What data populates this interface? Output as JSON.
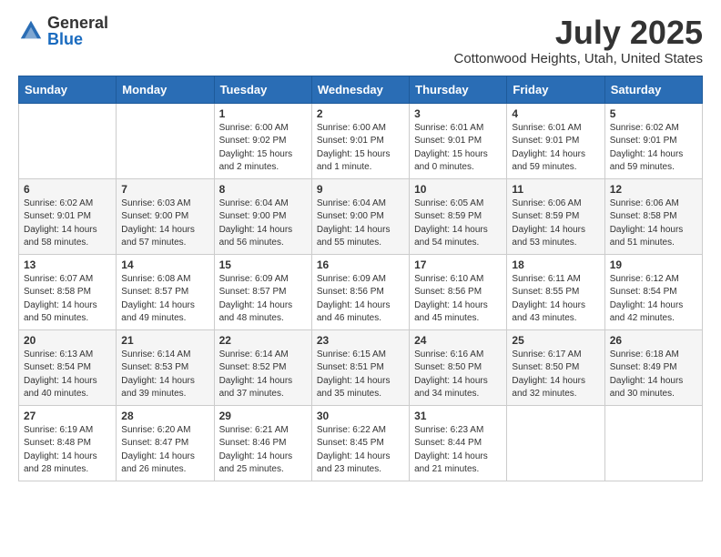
{
  "logo": {
    "general": "General",
    "blue": "Blue"
  },
  "title": {
    "month_year": "July 2025",
    "location": "Cottonwood Heights, Utah, United States"
  },
  "weekdays": [
    "Sunday",
    "Monday",
    "Tuesday",
    "Wednesday",
    "Thursday",
    "Friday",
    "Saturday"
  ],
  "weeks": [
    [
      {
        "day": "",
        "sunrise": "",
        "sunset": "",
        "daylight": ""
      },
      {
        "day": "",
        "sunrise": "",
        "sunset": "",
        "daylight": ""
      },
      {
        "day": "1",
        "sunrise": "Sunrise: 6:00 AM",
        "sunset": "Sunset: 9:02 PM",
        "daylight": "Daylight: 15 hours and 2 minutes."
      },
      {
        "day": "2",
        "sunrise": "Sunrise: 6:00 AM",
        "sunset": "Sunset: 9:01 PM",
        "daylight": "Daylight: 15 hours and 1 minute."
      },
      {
        "day": "3",
        "sunrise": "Sunrise: 6:01 AM",
        "sunset": "Sunset: 9:01 PM",
        "daylight": "Daylight: 15 hours and 0 minutes."
      },
      {
        "day": "4",
        "sunrise": "Sunrise: 6:01 AM",
        "sunset": "Sunset: 9:01 PM",
        "daylight": "Daylight: 14 hours and 59 minutes."
      },
      {
        "day": "5",
        "sunrise": "Sunrise: 6:02 AM",
        "sunset": "Sunset: 9:01 PM",
        "daylight": "Daylight: 14 hours and 59 minutes."
      }
    ],
    [
      {
        "day": "6",
        "sunrise": "Sunrise: 6:02 AM",
        "sunset": "Sunset: 9:01 PM",
        "daylight": "Daylight: 14 hours and 58 minutes."
      },
      {
        "day": "7",
        "sunrise": "Sunrise: 6:03 AM",
        "sunset": "Sunset: 9:00 PM",
        "daylight": "Daylight: 14 hours and 57 minutes."
      },
      {
        "day": "8",
        "sunrise": "Sunrise: 6:04 AM",
        "sunset": "Sunset: 9:00 PM",
        "daylight": "Daylight: 14 hours and 56 minutes."
      },
      {
        "day": "9",
        "sunrise": "Sunrise: 6:04 AM",
        "sunset": "Sunset: 9:00 PM",
        "daylight": "Daylight: 14 hours and 55 minutes."
      },
      {
        "day": "10",
        "sunrise": "Sunrise: 6:05 AM",
        "sunset": "Sunset: 8:59 PM",
        "daylight": "Daylight: 14 hours and 54 minutes."
      },
      {
        "day": "11",
        "sunrise": "Sunrise: 6:06 AM",
        "sunset": "Sunset: 8:59 PM",
        "daylight": "Daylight: 14 hours and 53 minutes."
      },
      {
        "day": "12",
        "sunrise": "Sunrise: 6:06 AM",
        "sunset": "Sunset: 8:58 PM",
        "daylight": "Daylight: 14 hours and 51 minutes."
      }
    ],
    [
      {
        "day": "13",
        "sunrise": "Sunrise: 6:07 AM",
        "sunset": "Sunset: 8:58 PM",
        "daylight": "Daylight: 14 hours and 50 minutes."
      },
      {
        "day": "14",
        "sunrise": "Sunrise: 6:08 AM",
        "sunset": "Sunset: 8:57 PM",
        "daylight": "Daylight: 14 hours and 49 minutes."
      },
      {
        "day": "15",
        "sunrise": "Sunrise: 6:09 AM",
        "sunset": "Sunset: 8:57 PM",
        "daylight": "Daylight: 14 hours and 48 minutes."
      },
      {
        "day": "16",
        "sunrise": "Sunrise: 6:09 AM",
        "sunset": "Sunset: 8:56 PM",
        "daylight": "Daylight: 14 hours and 46 minutes."
      },
      {
        "day": "17",
        "sunrise": "Sunrise: 6:10 AM",
        "sunset": "Sunset: 8:56 PM",
        "daylight": "Daylight: 14 hours and 45 minutes."
      },
      {
        "day": "18",
        "sunrise": "Sunrise: 6:11 AM",
        "sunset": "Sunset: 8:55 PM",
        "daylight": "Daylight: 14 hours and 43 minutes."
      },
      {
        "day": "19",
        "sunrise": "Sunrise: 6:12 AM",
        "sunset": "Sunset: 8:54 PM",
        "daylight": "Daylight: 14 hours and 42 minutes."
      }
    ],
    [
      {
        "day": "20",
        "sunrise": "Sunrise: 6:13 AM",
        "sunset": "Sunset: 8:54 PM",
        "daylight": "Daylight: 14 hours and 40 minutes."
      },
      {
        "day": "21",
        "sunrise": "Sunrise: 6:14 AM",
        "sunset": "Sunset: 8:53 PM",
        "daylight": "Daylight: 14 hours and 39 minutes."
      },
      {
        "day": "22",
        "sunrise": "Sunrise: 6:14 AM",
        "sunset": "Sunset: 8:52 PM",
        "daylight": "Daylight: 14 hours and 37 minutes."
      },
      {
        "day": "23",
        "sunrise": "Sunrise: 6:15 AM",
        "sunset": "Sunset: 8:51 PM",
        "daylight": "Daylight: 14 hours and 35 minutes."
      },
      {
        "day": "24",
        "sunrise": "Sunrise: 6:16 AM",
        "sunset": "Sunset: 8:50 PM",
        "daylight": "Daylight: 14 hours and 34 minutes."
      },
      {
        "day": "25",
        "sunrise": "Sunrise: 6:17 AM",
        "sunset": "Sunset: 8:50 PM",
        "daylight": "Daylight: 14 hours and 32 minutes."
      },
      {
        "day": "26",
        "sunrise": "Sunrise: 6:18 AM",
        "sunset": "Sunset: 8:49 PM",
        "daylight": "Daylight: 14 hours and 30 minutes."
      }
    ],
    [
      {
        "day": "27",
        "sunrise": "Sunrise: 6:19 AM",
        "sunset": "Sunset: 8:48 PM",
        "daylight": "Daylight: 14 hours and 28 minutes."
      },
      {
        "day": "28",
        "sunrise": "Sunrise: 6:20 AM",
        "sunset": "Sunset: 8:47 PM",
        "daylight": "Daylight: 14 hours and 26 minutes."
      },
      {
        "day": "29",
        "sunrise": "Sunrise: 6:21 AM",
        "sunset": "Sunset: 8:46 PM",
        "daylight": "Daylight: 14 hours and 25 minutes."
      },
      {
        "day": "30",
        "sunrise": "Sunrise: 6:22 AM",
        "sunset": "Sunset: 8:45 PM",
        "daylight": "Daylight: 14 hours and 23 minutes."
      },
      {
        "day": "31",
        "sunrise": "Sunrise: 6:23 AM",
        "sunset": "Sunset: 8:44 PM",
        "daylight": "Daylight: 14 hours and 21 minutes."
      },
      {
        "day": "",
        "sunrise": "",
        "sunset": "",
        "daylight": ""
      },
      {
        "day": "",
        "sunrise": "",
        "sunset": "",
        "daylight": ""
      }
    ]
  ]
}
